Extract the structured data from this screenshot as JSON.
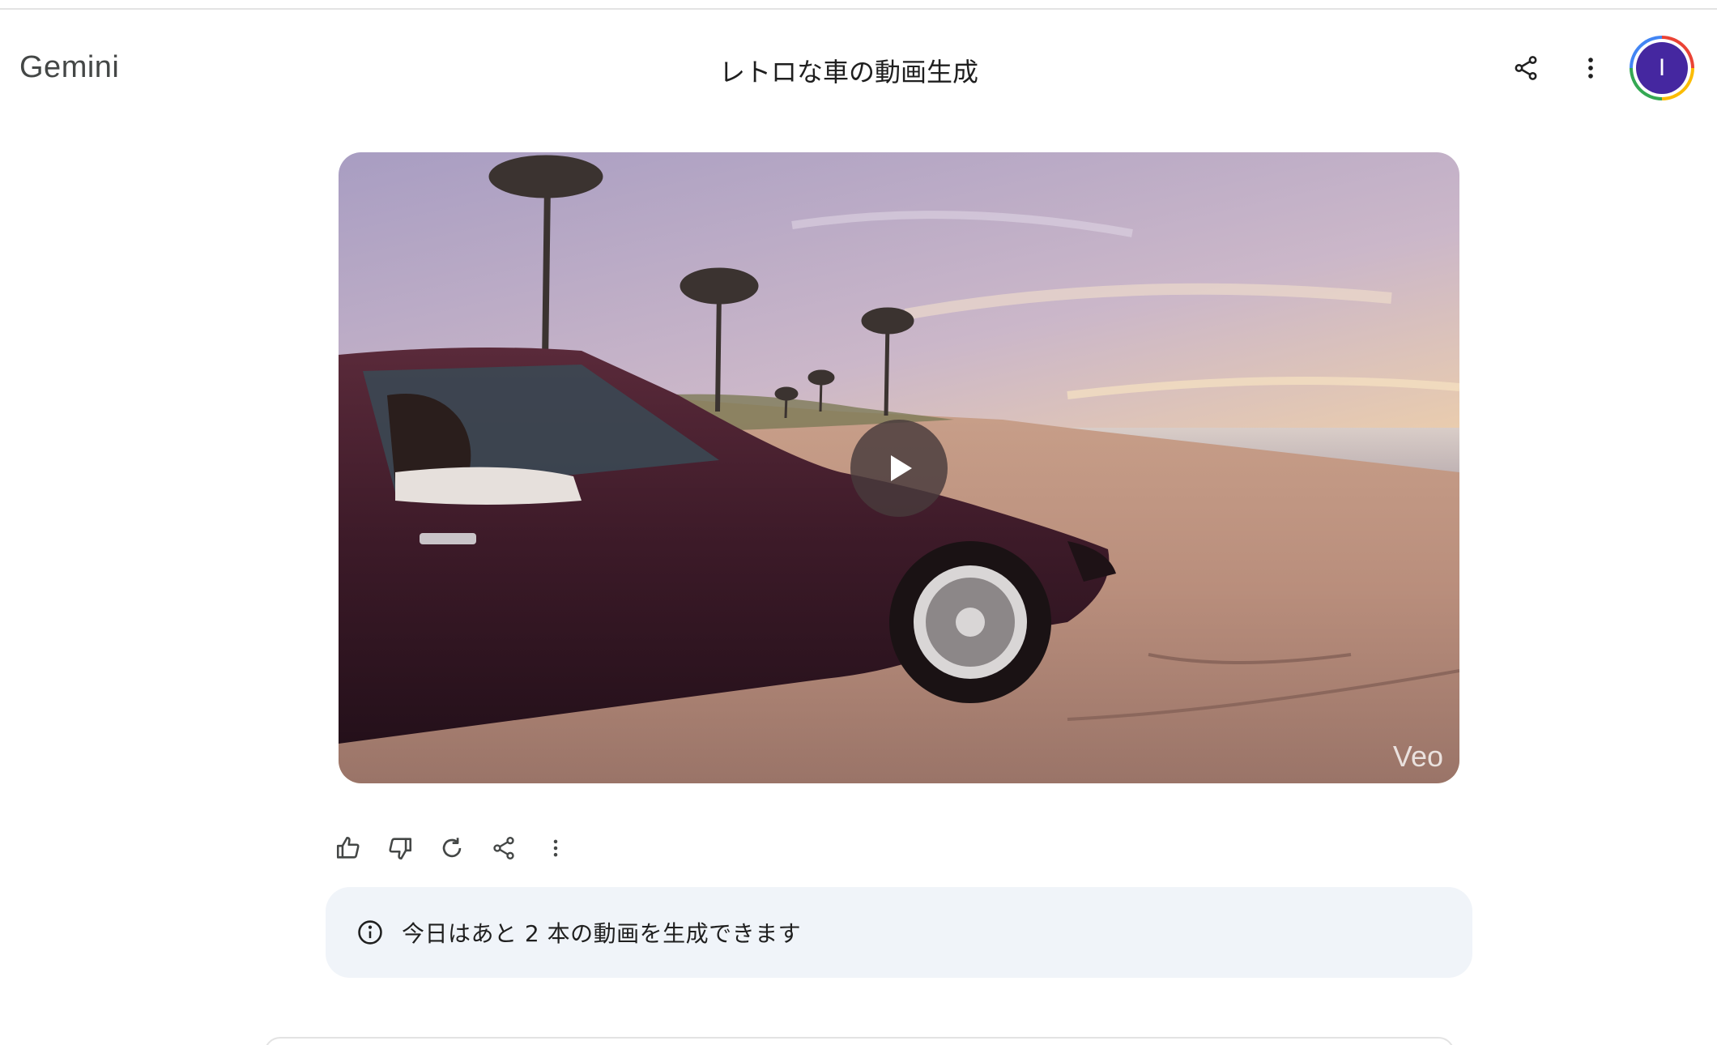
{
  "app": {
    "brand": "Gemini"
  },
  "conversation": {
    "title": "レトロな車の動画生成"
  },
  "header": {
    "share_icon": "share-icon",
    "more_icon": "more-vert-icon",
    "avatar_initial": "I"
  },
  "video": {
    "watermark": "Veo",
    "play_icon": "play-icon"
  },
  "actions": [
    {
      "icon": "thumb-up-icon"
    },
    {
      "icon": "thumb-down-icon"
    },
    {
      "icon": "refresh-icon"
    },
    {
      "icon": "share-icon"
    },
    {
      "icon": "more-vert-icon"
    }
  ],
  "notice": {
    "icon": "info-icon",
    "text": "今日はあと 2 本の動画を生成できます"
  },
  "colors": {
    "avatar_bg": "#4527a0",
    "notice_bg": "#f0f4f9",
    "icon": "#444746"
  }
}
